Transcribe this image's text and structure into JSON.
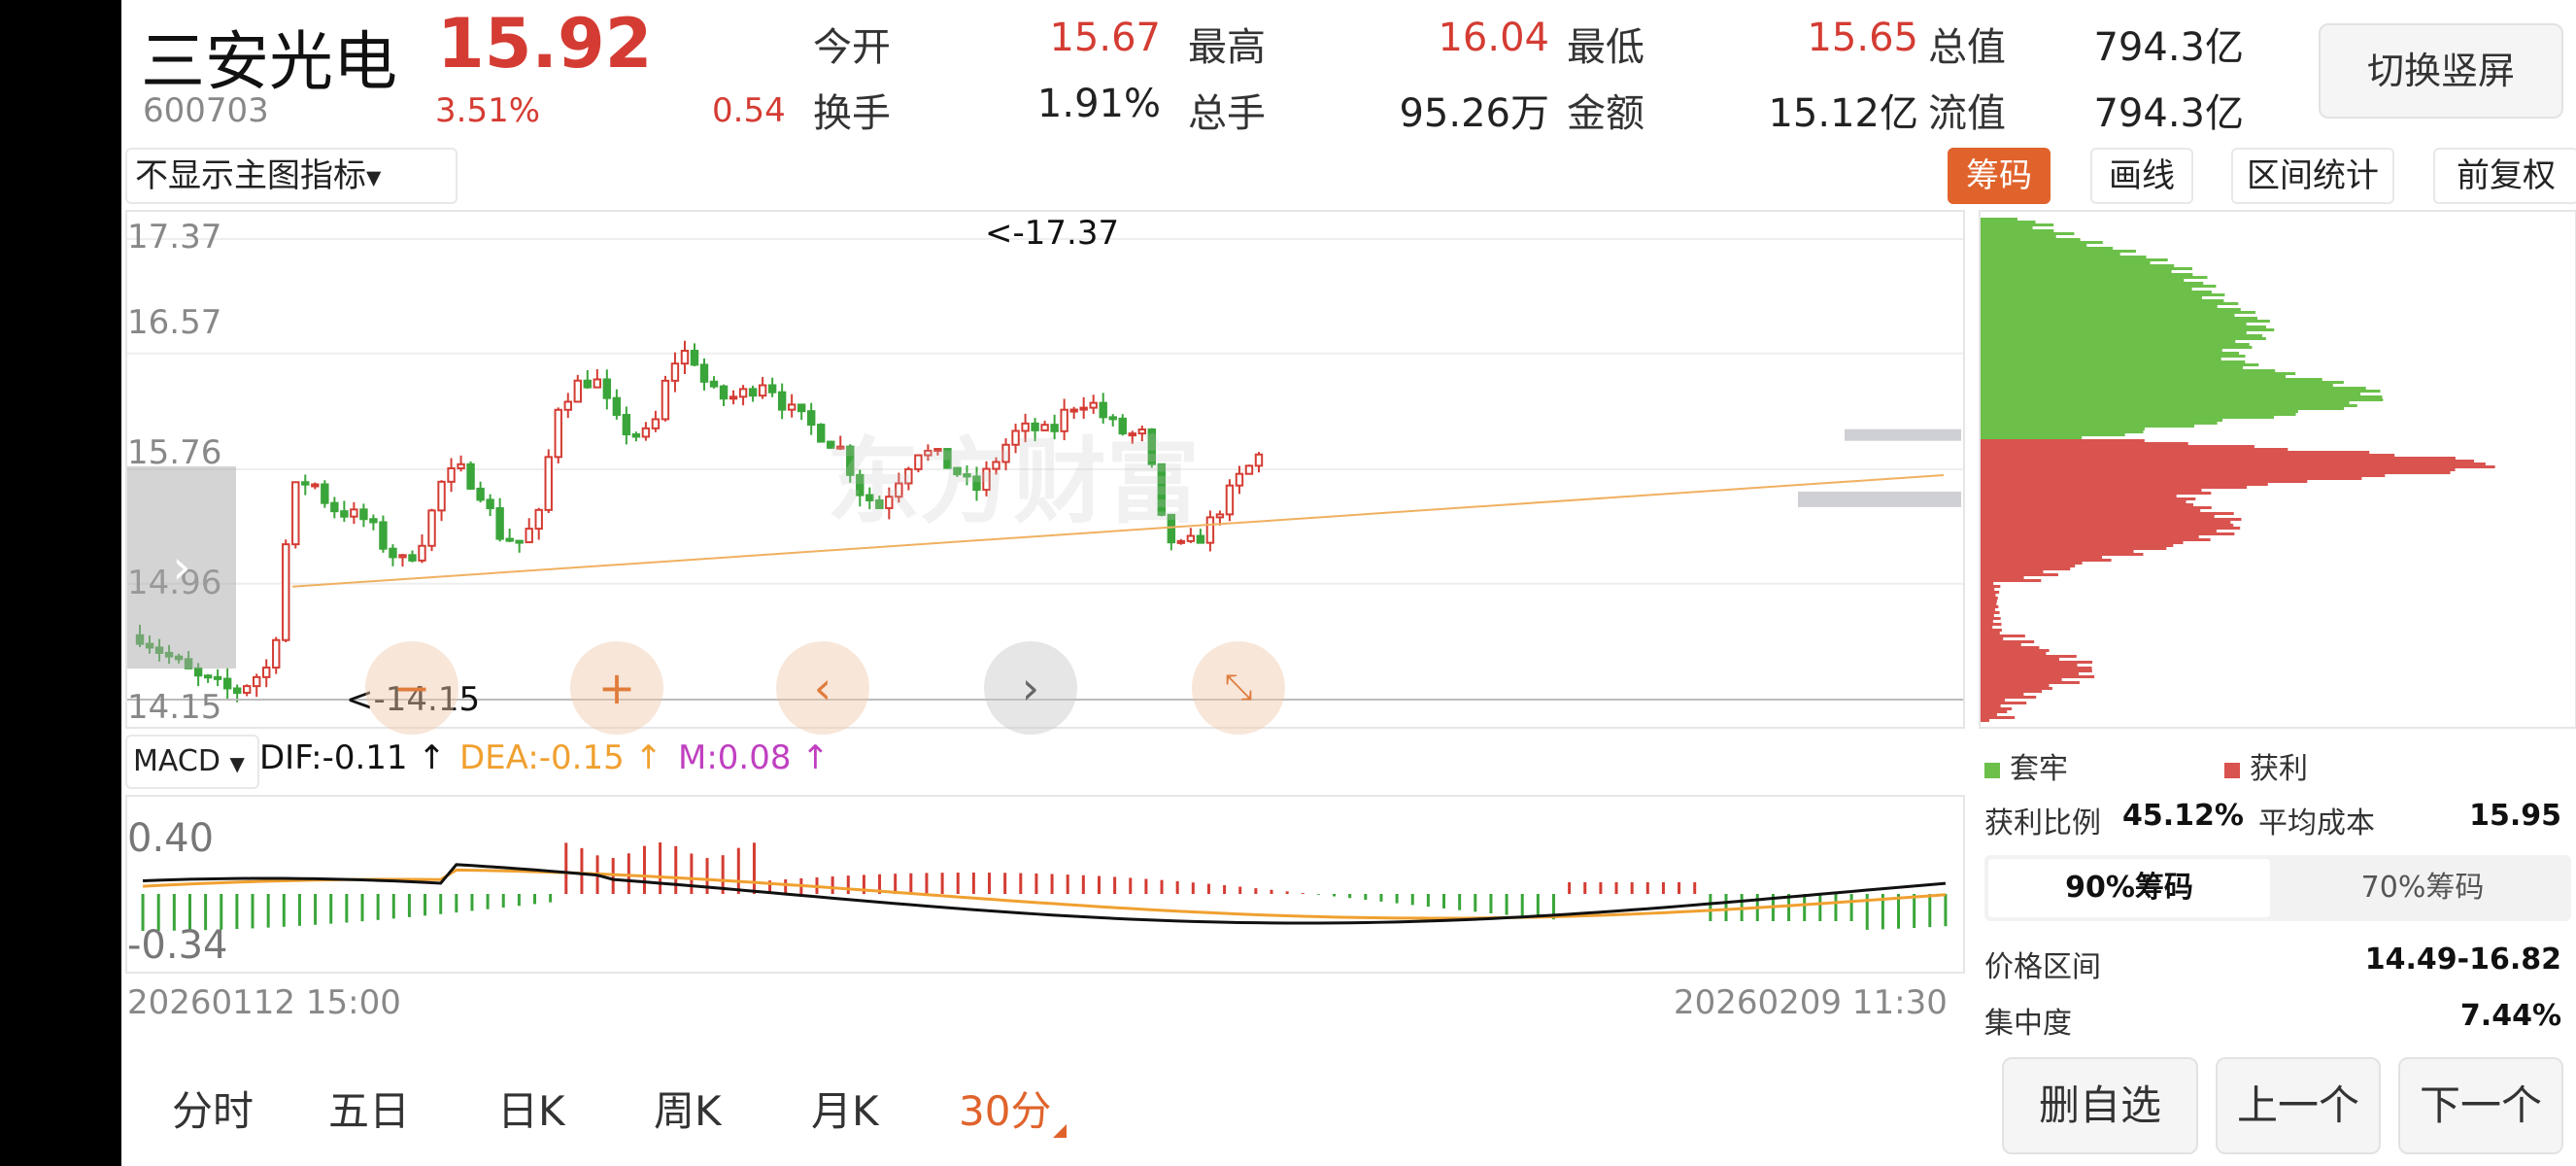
{
  "header": {
    "stock_name": "三安光电",
    "stock_code": "600703",
    "price": "15.92",
    "change_pct": "3.51%",
    "change_amt": "0.54",
    "stats": [
      {
        "label": "今开",
        "value": "15.67",
        "color": "#d43c33"
      },
      {
        "label": "最高",
        "value": "16.04",
        "color": "#d43c33"
      },
      {
        "label": "最低",
        "value": "15.65",
        "color": "#d43c33"
      },
      {
        "label": "总值",
        "value": "794.3亿",
        "color": "#222222"
      },
      {
        "label": "换手",
        "value": "1.91%",
        "color": "#222222"
      },
      {
        "label": "总手",
        "value": "95.26万",
        "color": "#222222"
      },
      {
        "label": "金额",
        "value": "15.12亿",
        "color": "#222222"
      },
      {
        "label": "流值",
        "value": "794.3亿",
        "color": "#222222"
      }
    ],
    "switch_button": "切换竖屏"
  },
  "toolbar": {
    "indicator_select": "不显示主图指标",
    "chips": "筹码",
    "draw_line": "画线",
    "range_stats": "区间统计",
    "adjust": "前复权"
  },
  "main_chart": {
    "y_labels": [
      "17.37",
      "16.57",
      "15.76",
      "14.96",
      "14.15"
    ],
    "high_marker": "<-17.37",
    "low_marker": "<-14.15",
    "watermark": "东方财富"
  },
  "macd": {
    "select": "MACD",
    "dif": "DIF:-0.11 ↑",
    "dea": "DEA:-0.15 ↑",
    "m": "M:0.08 ↑",
    "y_top": "0.40",
    "y_bottom": "-0.34",
    "date_start": "20260112 15:00",
    "date_end": "20260209 11:30"
  },
  "periods": [
    "分时",
    "五日",
    "日K",
    "周K",
    "月K",
    "30分"
  ],
  "chips_panel": {
    "legend_trapped": "套牢",
    "legend_profit": "获利",
    "profit_ratio_label": "获利比例",
    "profit_ratio": "45.12%",
    "avg_cost_label": "平均成本",
    "avg_cost": "15.95",
    "tab_90": "90%筹码",
    "tab_70": "70%筹码",
    "price_range_label": "价格区间",
    "price_range": "14.49-16.82",
    "concentration_label": "集中度",
    "concentration": "7.44%"
  },
  "bottom_buttons": {
    "remove": "删自选",
    "prev": "上一个",
    "next": "下一个"
  },
  "colors": {
    "up": "#d43c33",
    "down": "#3aa53a",
    "accent": "#e07c3c",
    "dea": "#f0a030",
    "m": "#c040c0"
  }
}
